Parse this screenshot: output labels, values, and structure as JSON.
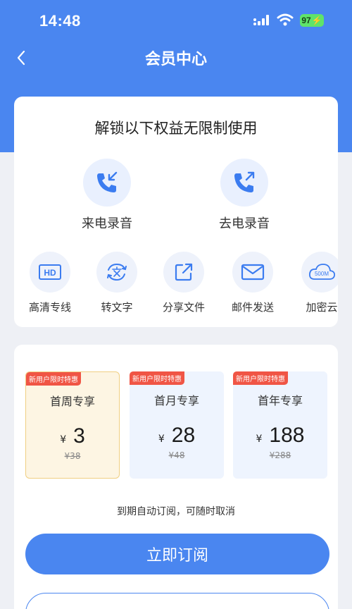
{
  "status_bar": {
    "time": "14:48",
    "battery": "97"
  },
  "nav": {
    "title": "会员中心"
  },
  "benefits": {
    "title": "解锁以下权益无限制使用",
    "primary": [
      {
        "label": "来电录音",
        "icon": "incoming-call-icon"
      },
      {
        "label": "去电录音",
        "icon": "outgoing-call-icon"
      }
    ],
    "secondary": [
      {
        "label": "高清专线",
        "icon": "hd-icon"
      },
      {
        "label": "转文字",
        "icon": "transcribe-icon"
      },
      {
        "label": "分享文件",
        "icon": "share-icon"
      },
      {
        "label": "邮件发送",
        "icon": "mail-icon"
      },
      {
        "label": "加密云",
        "icon": "cloud-icon",
        "icon_text": "500M"
      }
    ]
  },
  "plans": [
    {
      "badge": "新用户限时特惠",
      "name": "首周专享",
      "currency": "¥",
      "price": "3",
      "original": "¥38",
      "selected": true
    },
    {
      "badge": "新用户限时特惠",
      "name": "首月专享",
      "currency": "¥",
      "price": "28",
      "original": "¥48",
      "selected": false
    },
    {
      "badge": "新用户限时特惠",
      "name": "首年专享",
      "currency": "¥",
      "price": "188",
      "original": "¥288",
      "selected": false
    }
  ],
  "auto_renew_note": "到期自动订阅，可随时取消",
  "subscribe_label": "立即订阅",
  "colors": {
    "primary": "#4a86f0",
    "selected_bg": "#fdf5e3",
    "badge": "#f05545"
  }
}
